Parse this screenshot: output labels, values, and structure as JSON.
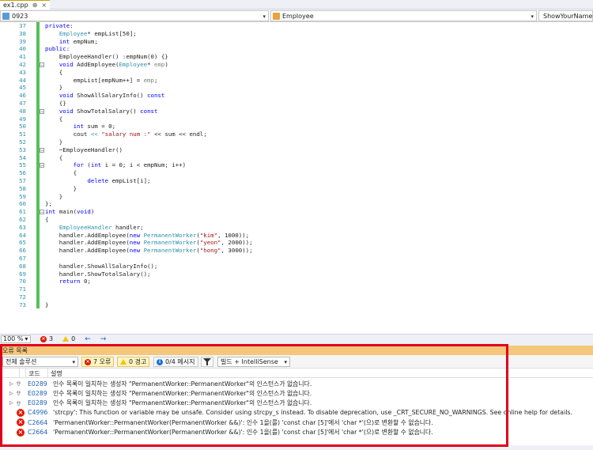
{
  "tab": {
    "title": "ex1.cpp",
    "pin": "⊕",
    "close": "×"
  },
  "navbar": {
    "project": "0923",
    "scope": "Employee",
    "member": "ShowYourName"
  },
  "code": [
    {
      "ln": "37",
      "html": "<span class=\"kw\">private</span>:"
    },
    {
      "ln": "38",
      "html": "    <span class=\"ty\">Employee</span>* empList[50];"
    },
    {
      "ln": "39",
      "html": "    <span class=\"kw\">int</span> empNum;"
    },
    {
      "ln": "40",
      "html": "<span class=\"kw\">public</span>:"
    },
    {
      "ln": "41",
      "html": "    EmployeeHandler() :empNum(0) {}"
    },
    {
      "ln": "42",
      "html": "    <span class=\"kw\">void</span> AddEmployee(<span class=\"ty\">Employee</span>* <span class=\"pm\">emp</span>)",
      "fold": true
    },
    {
      "ln": "43",
      "html": "    {"
    },
    {
      "ln": "44",
      "html": "        empList[empNum++] = <span class=\"pm\">emp</span>;"
    },
    {
      "ln": "45",
      "html": "    }"
    },
    {
      "ln": "46",
      "html": "    <span class=\"kw\">void</span> ShowAllSalaryInfo() <span class=\"kw\">const</span>"
    },
    {
      "ln": "47",
      "html": "    {}"
    },
    {
      "ln": "48",
      "html": "    <span class=\"kw\">void</span> ShowTotalSalary() <span class=\"kw\">const</span>",
      "fold": true
    },
    {
      "ln": "49",
      "html": "    {"
    },
    {
      "ln": "50",
      "html": "        <span class=\"kw\">int</span> sum = 0;"
    },
    {
      "ln": "51",
      "html": "        cout <span class=\"ty\">&lt;&lt;</span> <span class=\"st\">\"salary num :\"</span> &lt;&lt; sum &lt;&lt; endl;"
    },
    {
      "ln": "52",
      "html": "    }"
    },
    {
      "ln": "53",
      "html": "    ~EmployeeHandler()",
      "fold": true
    },
    {
      "ln": "54",
      "html": "    {"
    },
    {
      "ln": "55",
      "html": "        <span class=\"kw\">for</span> (<span class=\"kw\">int</span> i = 0; i &lt; empNum; i++)",
      "fold": true
    },
    {
      "ln": "56",
      "html": "        {"
    },
    {
      "ln": "57",
      "html": "            <span class=\"kw\">delete</span> empList[i];"
    },
    {
      "ln": "58",
      "html": "        }"
    },
    {
      "ln": "59",
      "html": "    }"
    },
    {
      "ln": "60",
      "html": "};"
    },
    {
      "ln": "61",
      "html": "<span class=\"kw\">int</span> main(<span class=\"kw\">void</span>)",
      "fold": true
    },
    {
      "ln": "62",
      "html": "{"
    },
    {
      "ln": "63",
      "html": "    <span class=\"ty\">EmployeeHandler</span> handler;"
    },
    {
      "ln": "64",
      "html": "    handler.AddEmployee(<span class=\"kw\">new</span> <span class=\"ty\">PermanentWorker</span>(<span class=\"st\">\"kim\"</span>, 1000));"
    },
    {
      "ln": "65",
      "html": "    handler.AddEmployee(<span class=\"kw\">new</span> <span class=\"ty\">PermanentWorker</span>(<span class=\"st\">\"yeon\"</span>, 2000));"
    },
    {
      "ln": "66",
      "html": "    handler.AddEmployee(<span class=\"kw\">new</span> <span class=\"ty\">PermanentWorker</span>(<span class=\"st\">\"hong\"</span>, 3000));"
    },
    {
      "ln": "67",
      "html": ""
    },
    {
      "ln": "68",
      "html": "    handler.ShowAllSalaryInfo();"
    },
    {
      "ln": "69",
      "html": "    handler.ShowTotalSalary();"
    },
    {
      "ln": "70",
      "html": "    <span class=\"kw\">return</span> 0;"
    },
    {
      "ln": "71",
      "html": ""
    },
    {
      "ln": "72",
      "html": ""
    },
    {
      "ln": "73",
      "html": "}"
    }
  ],
  "status": {
    "zoom": "100 %",
    "errors": "3",
    "warnings": "0",
    "back": "←",
    "forward": "→"
  },
  "errorList": {
    "title": "오류 목록",
    "scope": "전체 솔루션",
    "errorsBtn": "7 오류",
    "warningsBtn": "0 경고",
    "messagesBtn": "0/4 메시지",
    "buildFilter": "빌드 + IntelliSense",
    "colCode": "코드",
    "colDesc": "설명",
    "rows": [
      {
        "type": "intellisense",
        "code": "E0289",
        "desc": "인수 목록이 일치하는 생성자 \"PermanentWorker::PermanentWorker\"의 인스턴스가 없습니다."
      },
      {
        "type": "intellisense",
        "code": "E0289",
        "desc": "인수 목록이 일치하는 생성자 \"PermanentWorker::PermanentWorker\"의 인스턴스가 없습니다."
      },
      {
        "type": "intellisense",
        "code": "E0289",
        "desc": "인수 목록이 일치하는 생성자 \"PermanentWorker::PermanentWorker\"의 인스턴스가 없습니다."
      },
      {
        "type": "build",
        "code": "C4996",
        "desc": "'strcpy': This function or variable may be unsafe. Consider using strcpy_s instead. To disable deprecation, use _CRT_SECURE_NO_WARNINGS. See online help for details."
      },
      {
        "type": "build",
        "code": "C2664",
        "desc": "'PermanentWorker::PermanentWorker(PermanentWorker &&)': 인수 1을(를) 'const char [5]'에서 'char *'(으)로 변환할 수 없습니다."
      },
      {
        "type": "build",
        "code": "C2664",
        "desc": "'PermanentWorker::PermanentWorker(PermanentWorker &&)': 인수 1을(를) 'const char [5]'에서 'char *'(으)로 변환할 수 없습니다."
      }
    ]
  }
}
